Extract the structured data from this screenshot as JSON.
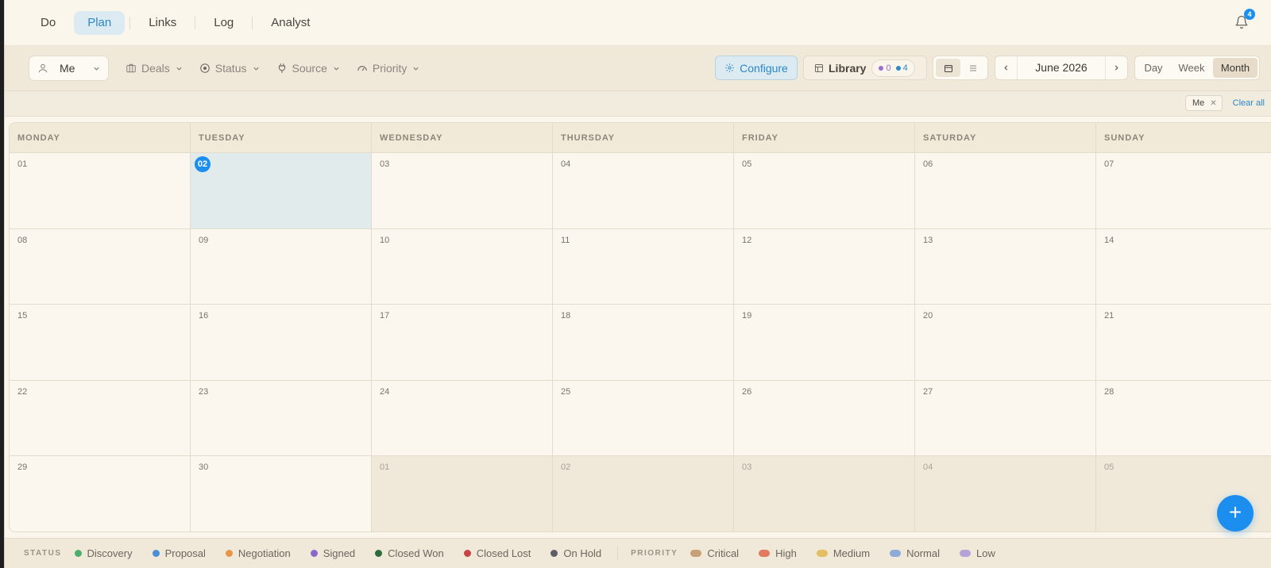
{
  "nav": {
    "tabs": [
      {
        "label": "Do"
      },
      {
        "label": "Plan"
      },
      {
        "label": "Links"
      },
      {
        "label": "Log"
      },
      {
        "label": "Analyst"
      }
    ],
    "active_tab": "Plan",
    "notifications_count": "4"
  },
  "toolbar": {
    "owner_select": "Me",
    "filters": [
      {
        "label": "Deals",
        "icon": "deals-icon"
      },
      {
        "label": "Status",
        "icon": "status-icon"
      },
      {
        "label": "Source",
        "icon": "plug-icon"
      },
      {
        "label": "Priority",
        "icon": "gauge-icon"
      }
    ],
    "configure_label": "Configure",
    "library_label": "Library",
    "library_count_purple": "0",
    "library_count_blue": "4",
    "month_label": "June 2026",
    "range_day": "Day",
    "range_week": "Week",
    "range_month": "Month",
    "active_range": "Month"
  },
  "active_filters": {
    "chip_label": "Me",
    "clear_all_label": "Clear all"
  },
  "calendar": {
    "weekdays": [
      "MONDAY",
      "TUESDAY",
      "WEDNESDAY",
      "THURSDAY",
      "FRIDAY",
      "SATURDAY",
      "SUNDAY"
    ],
    "today": "02",
    "weeks": [
      [
        "01",
        "02",
        "03",
        "04",
        "05",
        "06",
        "07"
      ],
      [
        "08",
        "09",
        "10",
        "11",
        "12",
        "13",
        "14"
      ],
      [
        "15",
        "16",
        "17",
        "18",
        "19",
        "20",
        "21"
      ],
      [
        "22",
        "23",
        "24",
        "25",
        "26",
        "27",
        "28"
      ],
      [
        "29",
        "30",
        "01",
        "02",
        "03",
        "04",
        "05"
      ]
    ],
    "other_month_cells": [
      [
        4,
        2
      ],
      [
        4,
        3
      ],
      [
        4,
        4
      ],
      [
        4,
        5
      ],
      [
        4,
        6
      ]
    ]
  },
  "legend": {
    "status_title": "STATUS",
    "status_items": [
      {
        "label": "Discovery",
        "color": "#4caf6d"
      },
      {
        "label": "Proposal",
        "color": "#4a8fd6"
      },
      {
        "label": "Negotiation",
        "color": "#e8974a"
      },
      {
        "label": "Signed",
        "color": "#8a67c9"
      },
      {
        "label": "Closed Won",
        "color": "#2f6b3c"
      },
      {
        "label": "Closed Lost",
        "color": "#c94444"
      },
      {
        "label": "On Hold",
        "color": "#5e5e66"
      }
    ],
    "priority_title": "PRIORITY",
    "priority_items": [
      {
        "label": "Critical",
        "color": "#c7a07a"
      },
      {
        "label": "High",
        "color": "#e07b5e"
      },
      {
        "label": "Medium",
        "color": "#e3be62"
      },
      {
        "label": "Normal",
        "color": "#8eaad6"
      },
      {
        "label": "Low",
        "color": "#b7a2d8"
      }
    ]
  },
  "colors": {
    "accent": "#1c8ef0",
    "today_bg": "#e1ebec"
  }
}
